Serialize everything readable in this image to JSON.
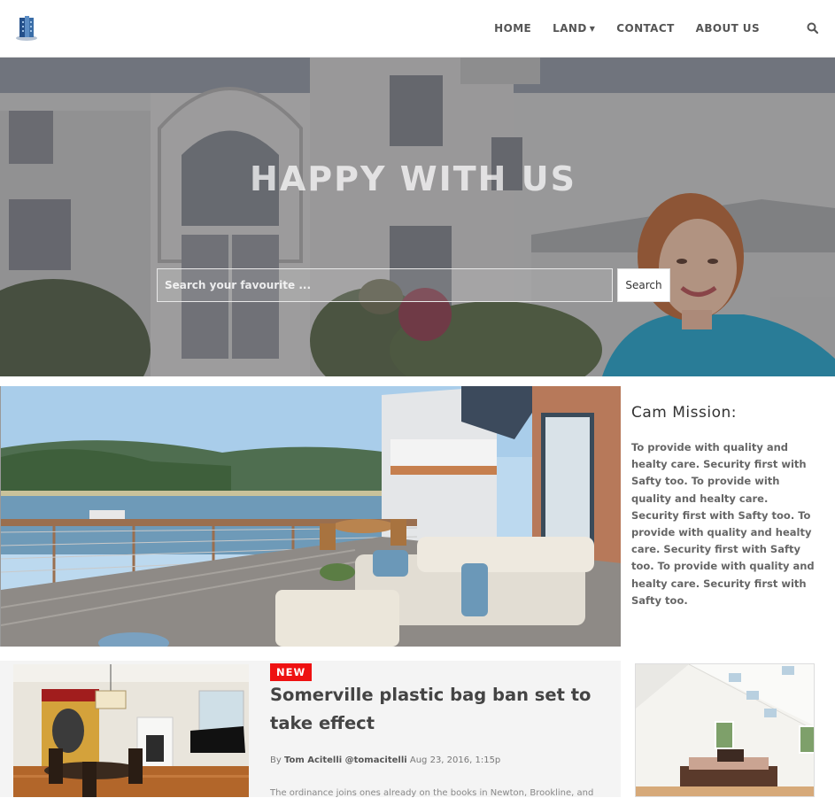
{
  "nav": {
    "items": [
      {
        "label": "HOME"
      },
      {
        "label": "LAND",
        "has_caret": true
      },
      {
        "label": "CONTACT"
      },
      {
        "label": "ABOUT US"
      }
    ],
    "search_icon": "search-icon",
    "logo_icon": "building-logo-icon"
  },
  "hero": {
    "title": "HAPPY WITH US",
    "search_placeholder": "Search your favourite ...",
    "search_button": "Search"
  },
  "mission": {
    "title": "Cam Mission:",
    "text": "To provide with quality and healty care. Security first with Safty too. To provide with quality and healty care. Security first with Safty too. To provide with quality and healty care. Security first with Safty too. To provide with quality and healty care. Security first with Safty too."
  },
  "article": {
    "badge": "NEW",
    "title": "Somerville plastic bag ban set to take effect",
    "by": "By",
    "author": "Tom Acitelli @tomacitelli",
    "date": "Aug 23, 2016, 1:15p",
    "excerpt": "The ordinance joins ones already on the books in Newton, Brookline, and"
  },
  "colors": {
    "badge": "#ee1111",
    "nav_text": "#555555",
    "panel": "#f4f4f4"
  }
}
